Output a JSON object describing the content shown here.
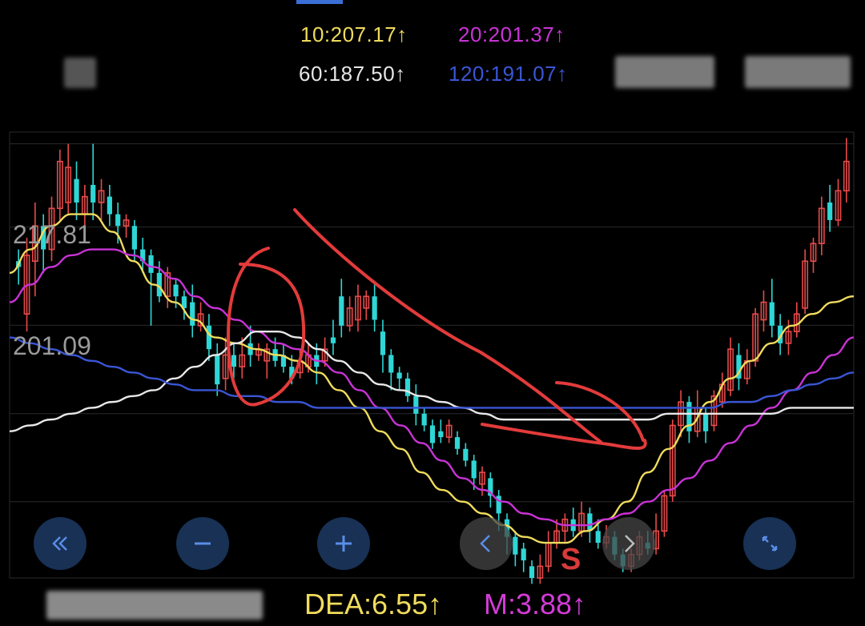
{
  "ma_legend": {
    "ma10": {
      "label": "10:207.17↑",
      "color": "#f0dc5c"
    },
    "ma20": {
      "label": "20:201.37↑",
      "color": "#c933d6"
    },
    "ma60": {
      "label": "60:187.50↑",
      "color": "#e8e8e8"
    },
    "ma120": {
      "label": "120:191.07↑",
      "color": "#3a56d6"
    }
  },
  "chart_data": {
    "type": "candlestick",
    "y_ticks": [
      {
        "label": "217.81",
        "value": 217.81
      },
      {
        "label": "201.09",
        "value": 201.09
      }
    ],
    "ylim": [
      172,
      234
    ],
    "grid": true,
    "candles": [
      {
        "o": 212,
        "c": 211,
        "h": 214,
        "l": 208
      },
      {
        "o": 203,
        "c": 213,
        "h": 216,
        "l": 200
      },
      {
        "o": 212,
        "c": 218,
        "h": 222,
        "l": 206
      },
      {
        "o": 218,
        "c": 214,
        "h": 220,
        "l": 210
      },
      {
        "o": 214,
        "c": 221,
        "h": 223,
        "l": 212
      },
      {
        "o": 221,
        "c": 229,
        "h": 231,
        "l": 219
      },
      {
        "o": 222,
        "c": 228,
        "h": 232,
        "l": 220
      },
      {
        "o": 226,
        "c": 222,
        "h": 229,
        "l": 219
      },
      {
        "o": 220,
        "c": 223,
        "h": 225,
        "l": 218
      },
      {
        "o": 225,
        "c": 222,
        "h": 232,
        "l": 219
      },
      {
        "o": 222,
        "c": 224,
        "h": 226,
        "l": 219
      },
      {
        "o": 223,
        "c": 220,
        "h": 225,
        "l": 218
      },
      {
        "o": 220,
        "c": 218,
        "h": 222,
        "l": 215
      },
      {
        "o": 218,
        "c": 219,
        "h": 220,
        "l": 216
      },
      {
        "o": 218,
        "c": 214,
        "h": 219,
        "l": 212
      },
      {
        "o": 214,
        "c": 212,
        "h": 216,
        "l": 210
      },
      {
        "o": 213,
        "c": 210,
        "h": 214,
        "l": 201
      },
      {
        "o": 210,
        "c": 206,
        "h": 212,
        "l": 205
      },
      {
        "o": 206,
        "c": 210,
        "h": 211,
        "l": 204
      },
      {
        "o": 208,
        "c": 206,
        "h": 209,
        "l": 204
      },
      {
        "o": 206,
        "c": 204,
        "h": 207,
        "l": 202
      },
      {
        "o": 205,
        "c": 201,
        "h": 208,
        "l": 199
      },
      {
        "o": 201,
        "c": 203,
        "h": 205,
        "l": 200
      },
      {
        "o": 201,
        "c": 197,
        "h": 203,
        "l": 195
      },
      {
        "o": 196,
        "c": 191,
        "h": 198,
        "l": 189
      },
      {
        "o": 192,
        "c": 196,
        "h": 199,
        "l": 190
      },
      {
        "o": 196,
        "c": 194,
        "h": 198,
        "l": 192
      },
      {
        "o": 194,
        "c": 196,
        "h": 199,
        "l": 192
      },
      {
        "o": 198,
        "c": 196,
        "h": 201,
        "l": 194
      },
      {
        "o": 196,
        "c": 197,
        "h": 198,
        "l": 195
      },
      {
        "o": 195,
        "c": 197,
        "h": 198,
        "l": 192
      },
      {
        "o": 197,
        "c": 195,
        "h": 199,
        "l": 194
      },
      {
        "o": 196,
        "c": 194,
        "h": 198,
        "l": 193
      },
      {
        "o": 194,
        "c": 192,
        "h": 196,
        "l": 191
      },
      {
        "o": 193,
        "c": 195,
        "h": 197,
        "l": 192
      },
      {
        "o": 194,
        "c": 196,
        "h": 198,
        "l": 193
      },
      {
        "o": 196,
        "c": 194,
        "h": 198,
        "l": 191
      },
      {
        "o": 195,
        "c": 197,
        "h": 199,
        "l": 194
      },
      {
        "o": 199,
        "c": 198,
        "h": 202,
        "l": 196
      },
      {
        "o": 206,
        "c": 201,
        "h": 209,
        "l": 199
      },
      {
        "o": 201,
        "c": 204,
        "h": 206,
        "l": 200
      },
      {
        "o": 202,
        "c": 206,
        "h": 208,
        "l": 200
      },
      {
        "o": 204,
        "c": 206,
        "h": 207,
        "l": 202
      },
      {
        "o": 206,
        "c": 202,
        "h": 208,
        "l": 200
      },
      {
        "o": 200,
        "c": 196,
        "h": 202,
        "l": 193
      },
      {
        "o": 196,
        "c": 193,
        "h": 197,
        "l": 190
      },
      {
        "o": 193,
        "c": 192,
        "h": 194,
        "l": 190
      },
      {
        "o": 192,
        "c": 189,
        "h": 193,
        "l": 188
      },
      {
        "o": 189,
        "c": 186,
        "h": 191,
        "l": 184
      },
      {
        "o": 186,
        "c": 184,
        "h": 187,
        "l": 183
      },
      {
        "o": 184,
        "c": 181,
        "h": 185,
        "l": 180
      },
      {
        "o": 183,
        "c": 182,
        "h": 185,
        "l": 181
      },
      {
        "o": 182,
        "c": 184,
        "h": 185,
        "l": 181
      },
      {
        "o": 182,
        "c": 180,
        "h": 183,
        "l": 179
      },
      {
        "o": 180,
        "c": 178,
        "h": 181,
        "l": 177
      },
      {
        "o": 178,
        "c": 175,
        "h": 179,
        "l": 173
      },
      {
        "o": 174,
        "c": 176,
        "h": 177,
        "l": 172
      },
      {
        "o": 175,
        "c": 172,
        "h": 176,
        "l": 170
      },
      {
        "o": 172,
        "c": 169,
        "h": 173,
        "l": 166
      },
      {
        "o": 168,
        "c": 165,
        "h": 169,
        "l": 162
      },
      {
        "o": 165,
        "c": 162,
        "h": 166,
        "l": 160
      },
      {
        "o": 163,
        "c": 161,
        "h": 164,
        "l": 159
      },
      {
        "o": 160,
        "c": 158,
        "h": 161,
        "l": 157
      },
      {
        "o": 158,
        "c": 160,
        "h": 162,
        "l": 157
      },
      {
        "o": 160,
        "c": 164,
        "h": 166,
        "l": 159
      },
      {
        "o": 164,
        "c": 166,
        "h": 168,
        "l": 163
      },
      {
        "o": 166,
        "c": 168,
        "h": 169,
        "l": 164
      },
      {
        "o": 168,
        "c": 166,
        "h": 170,
        "l": 165
      },
      {
        "o": 166,
        "c": 169,
        "h": 171,
        "l": 165
      },
      {
        "o": 169,
        "c": 166,
        "h": 170,
        "l": 164
      },
      {
        "o": 166,
        "c": 164,
        "h": 168,
        "l": 163
      },
      {
        "o": 164,
        "c": 165,
        "h": 167,
        "l": 163
      },
      {
        "o": 165,
        "c": 162,
        "h": 166,
        "l": 161
      },
      {
        "o": 162,
        "c": 160,
        "h": 163,
        "l": 159
      },
      {
        "o": 160,
        "c": 162,
        "h": 163,
        "l": 159
      },
      {
        "o": 162,
        "c": 165,
        "h": 166,
        "l": 161
      },
      {
        "o": 164,
        "c": 163,
        "h": 166,
        "l": 162
      },
      {
        "o": 163,
        "c": 166,
        "h": 169,
        "l": 162
      },
      {
        "o": 166,
        "c": 172,
        "h": 173,
        "l": 165
      },
      {
        "o": 172,
        "c": 184,
        "h": 185,
        "l": 171
      },
      {
        "o": 184,
        "c": 188,
        "h": 190,
        "l": 182
      },
      {
        "o": 188,
        "c": 183,
        "h": 189,
        "l": 181
      },
      {
        "o": 183,
        "c": 187,
        "h": 190,
        "l": 182
      },
      {
        "o": 186,
        "c": 183,
        "h": 187,
        "l": 181
      },
      {
        "o": 184,
        "c": 189,
        "h": 190,
        "l": 183
      },
      {
        "o": 188,
        "c": 191,
        "h": 193,
        "l": 187
      },
      {
        "o": 190,
        "c": 197,
        "h": 199,
        "l": 189
      },
      {
        "o": 196,
        "c": 192,
        "h": 198,
        "l": 190
      },
      {
        "o": 192,
        "c": 195,
        "h": 197,
        "l": 191
      },
      {
        "o": 195,
        "c": 203,
        "h": 204,
        "l": 194
      },
      {
        "o": 202,
        "c": 205,
        "h": 207,
        "l": 200
      },
      {
        "o": 205,
        "c": 201,
        "h": 209,
        "l": 199
      },
      {
        "o": 201,
        "c": 198,
        "h": 203,
        "l": 196
      },
      {
        "o": 198,
        "c": 200,
        "h": 202,
        "l": 196
      },
      {
        "o": 200,
        "c": 203,
        "h": 205,
        "l": 199
      },
      {
        "o": 204,
        "c": 212,
        "h": 214,
        "l": 203
      },
      {
        "o": 212,
        "c": 215,
        "h": 216,
        "l": 210
      },
      {
        "o": 215,
        "c": 221,
        "h": 223,
        "l": 213
      },
      {
        "o": 222,
        "c": 219,
        "h": 225,
        "l": 217
      },
      {
        "o": 219,
        "c": 224,
        "h": 226,
        "l": 218
      },
      {
        "o": 224,
        "c": 229,
        "h": 233,
        "l": 222
      }
    ],
    "ma_series": [
      {
        "name": "10",
        "color": "#f0dc5c",
        "values": [
          210,
          214,
          218,
          220,
          220,
          217,
          212,
          208,
          205,
          202,
          199,
          198,
          197,
          196,
          195,
          193,
          190,
          187,
          183,
          180,
          176,
          173,
          171,
          169,
          167,
          165,
          164,
          164,
          166,
          168,
          171,
          176,
          180,
          184,
          188,
          192,
          195,
          198,
          201,
          203,
          205,
          206
        ]
      },
      {
        "name": "20",
        "color": "#c933d6",
        "values": [
          205,
          208,
          211,
          213,
          214,
          214,
          213,
          211,
          209,
          206,
          204,
          202,
          200,
          198,
          197,
          195,
          193,
          190,
          187,
          184,
          181,
          178,
          175,
          173,
          171,
          169,
          168,
          167,
          167,
          168,
          169,
          171,
          173,
          175,
          178,
          181,
          184,
          187,
          190,
          193,
          196,
          199
        ]
      },
      {
        "name": "60",
        "color": "#e8e8e8",
        "values": [
          183,
          184,
          185,
          186,
          187,
          188,
          189,
          190,
          192,
          194,
          196,
          198,
          200,
          200,
          199,
          197,
          195,
          193,
          191,
          190,
          189,
          188,
          187,
          186,
          185,
          185,
          185,
          185,
          185,
          185,
          185,
          185,
          186,
          186,
          186,
          186,
          186,
          186,
          187,
          187,
          187,
          187
        ]
      },
      {
        "name": "120",
        "color": "#3a56d6",
        "values": [
          199,
          198,
          197,
          196,
          195,
          194,
          193,
          192,
          191,
          190,
          190,
          189,
          189,
          188,
          188,
          187,
          187,
          187,
          187,
          187,
          187,
          187,
          187,
          187,
          187,
          187,
          187,
          187,
          187,
          187,
          187,
          187,
          187,
          187,
          187,
          188,
          188,
          189,
          190,
          191,
          192,
          193
        ]
      }
    ]
  },
  "footer": {
    "dea": "DEA:6.55↑",
    "m": "M:3.88↑"
  },
  "signal_letter": "S",
  "icons": [
    "rewind-icon",
    "minus-icon",
    "plus-icon",
    "chevron-left-icon",
    "chevron-right-icon",
    "expand-icon"
  ]
}
